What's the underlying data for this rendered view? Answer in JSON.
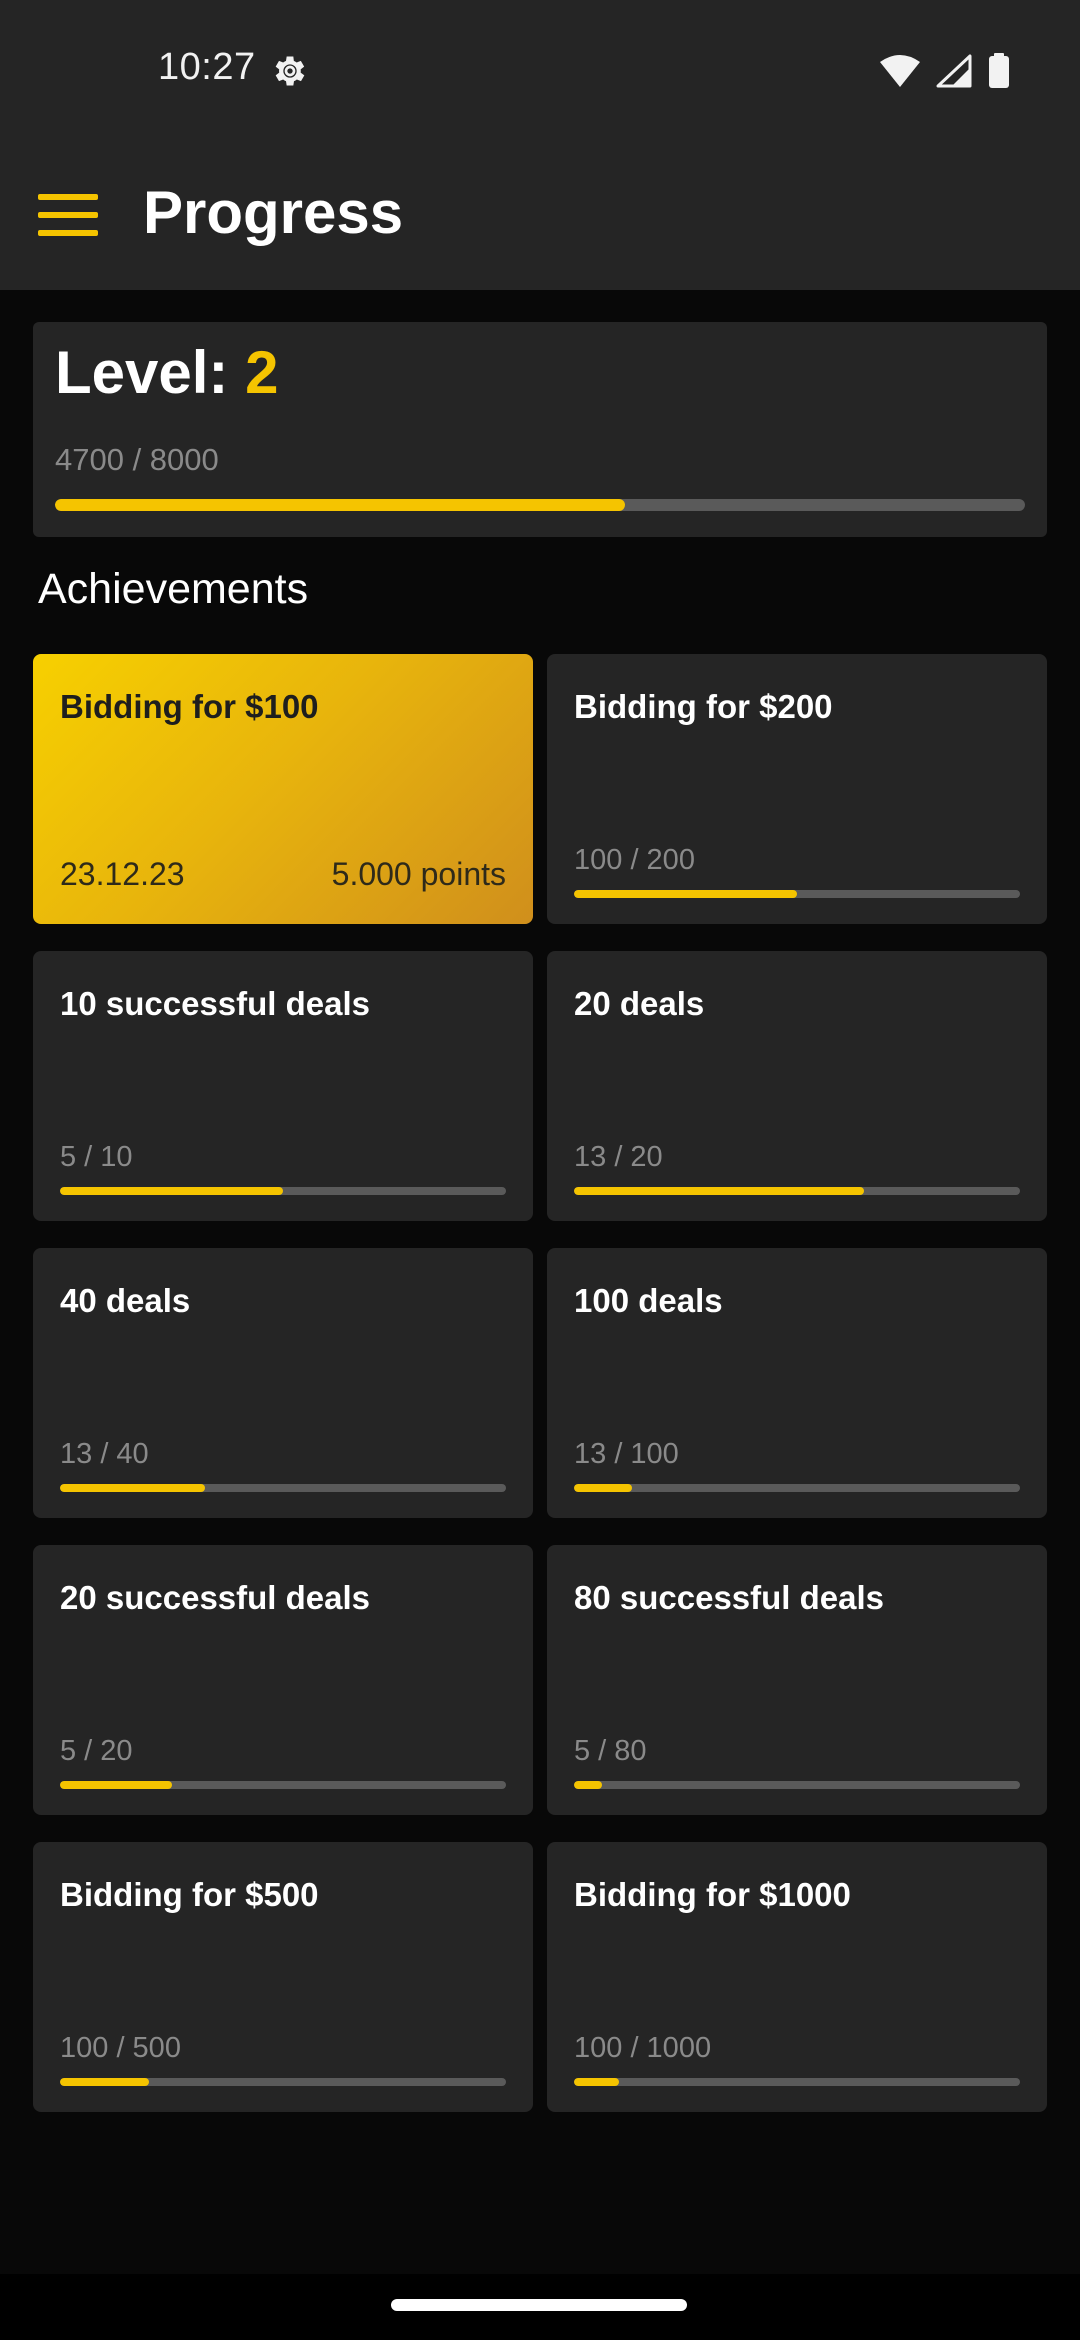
{
  "status_bar": {
    "time": "10:27",
    "icons": [
      "gear-icon",
      "wifi-icon",
      "signal-icon",
      "battery-icon"
    ]
  },
  "app_bar": {
    "title": "Progress",
    "menu_icon": "menu-icon"
  },
  "level": {
    "label": "Level: ",
    "value": "2",
    "progress_text": "4700 / 8000",
    "progress": 0.5875
  },
  "achievements_title": "Achievements",
  "achievements": [
    {
      "title": "Bidding for $100",
      "completed": true,
      "date": "23.12.23",
      "points": "5.000 points"
    },
    {
      "title": "Bidding for $200",
      "completed": false,
      "progress_text": "100 / 200",
      "progress": 0.5
    },
    {
      "title": "10 successful deals",
      "completed": false,
      "progress_text": "5 / 10",
      "progress": 0.5
    },
    {
      "title": "20 deals",
      "completed": false,
      "progress_text": "13 / 20",
      "progress": 0.65
    },
    {
      "title": "40 deals",
      "completed": false,
      "progress_text": "13 / 40",
      "progress": 0.325
    },
    {
      "title": "100 deals",
      "completed": false,
      "progress_text": "13 / 100",
      "progress": 0.13
    },
    {
      "title": "20 successful deals",
      "completed": false,
      "progress_text": "5 / 20",
      "progress": 0.25
    },
    {
      "title": "80 successful deals",
      "completed": false,
      "progress_text": "5 / 80",
      "progress": 0.0625
    },
    {
      "title": "Bidding for $500",
      "completed": false,
      "progress_text": "100 / 500",
      "progress": 0.2
    },
    {
      "title": "Bidding for $1000",
      "completed": false,
      "progress_text": "100 / 1000",
      "progress": 0.1
    }
  ],
  "colors": {
    "accent": "#f5c400",
    "background": "#080808",
    "surface": "#252525",
    "muted_text": "#8a8a8a",
    "track": "#5a5a5a"
  }
}
